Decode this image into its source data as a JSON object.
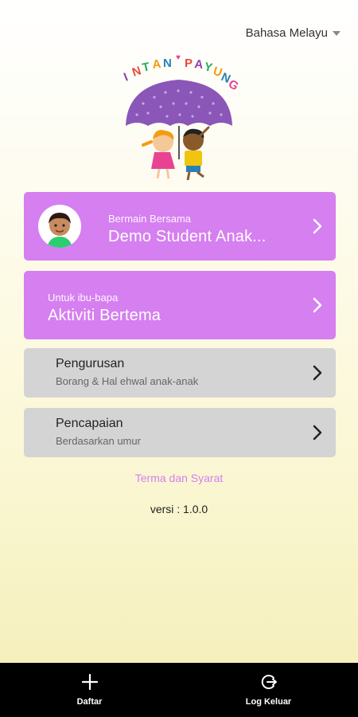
{
  "language": {
    "label": "Bahasa Melayu"
  },
  "logo": {
    "text": "INTAN PAYUNG"
  },
  "cards": {
    "play": {
      "subtitle": "Bermain Bersama",
      "title": "Demo Student Anak..."
    },
    "parents": {
      "subtitle": "Untuk ibu-bapa",
      "title": "Aktiviti Bertema"
    },
    "management": {
      "title": "Pengurusan",
      "subtitle": "Borang & Hal ehwal anak-anak"
    },
    "achievement": {
      "title": "Pencapaian",
      "subtitle": "Berdasarkan umur"
    }
  },
  "links": {
    "terms": "Terma dan Syarat"
  },
  "version": "versi : 1.0.0",
  "bottom_nav": {
    "register": "Daftar",
    "logout": "Log Keluar"
  },
  "colors": {
    "accent_purple": "#d57ff0",
    "card_grey": "#d4d4d4",
    "nav_bg": "#000000"
  }
}
